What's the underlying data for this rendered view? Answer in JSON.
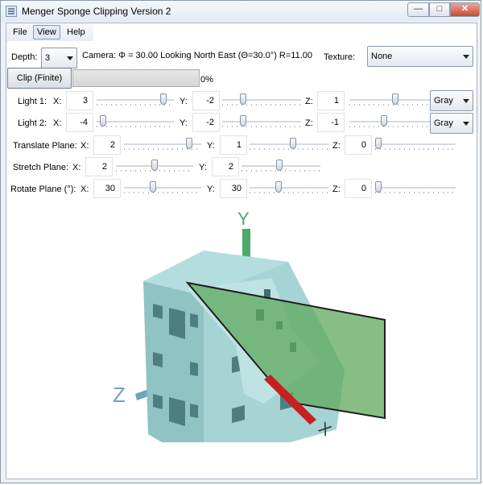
{
  "window": {
    "title": "Menger Sponge Clipping Version 2"
  },
  "menu": [
    "File",
    "View",
    "Help"
  ],
  "depth": {
    "label": "Depth:",
    "value": "3"
  },
  "camera_text": "Camera: Φ = 30.00 Looking North East (Θ=30.0°)   R=11.00",
  "texture": {
    "label": "Texture:",
    "value": "None"
  },
  "clip": {
    "button": "Clip (Finite)",
    "progress_text": "0%",
    "progress": 0
  },
  "light1": {
    "label": "Light 1:",
    "x": "3",
    "y": "-2",
    "z": "1",
    "color": "Gray"
  },
  "light2": {
    "label": "Light 2:",
    "x": "-4",
    "y": "-2",
    "z": "-1",
    "color": "Gray"
  },
  "translate": {
    "label": "Translate Plane:",
    "x": "2",
    "y": "1",
    "z": "0"
  },
  "stretch": {
    "label": "Stretch Plane:",
    "x": "2",
    "y": "2"
  },
  "rotate": {
    "label": "Rotate Plane (°):",
    "x": "30",
    "y": "30",
    "z": "0"
  },
  "axis_labels": {
    "x": "X",
    "y": "Y",
    "z": "Z"
  },
  "coord_labels": {
    "x": "X:",
    "y": "Y:",
    "z": "Z:"
  },
  "sliders": {
    "light1_x": 0.9,
    "light1_y": 0.24,
    "light1_z": 0.58,
    "light2_x": 0.05,
    "light2_y": 0.24,
    "light2_z": 0.42,
    "translate_x": 0.87,
    "translate_y": 0.55,
    "translate_z": 0.0,
    "stretch_x": 0.5,
    "stretch_y": 0.48,
    "rotate_x": 0.36,
    "rotate_y": 0.36,
    "rotate_z": 0.0
  },
  "colors": {
    "sponge": "#9fd0d0",
    "plane": "#5da85d",
    "x_axis": "#c82020",
    "y_axis": "#4caa6c",
    "z_axis": "#6fa3bd"
  }
}
